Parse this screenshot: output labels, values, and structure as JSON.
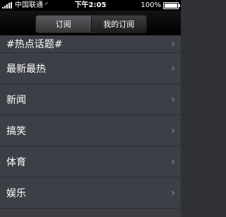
{
  "status_bar": {
    "carrier": "中国联通",
    "time": "下午2:05",
    "battery": "100%"
  },
  "segmented_control": {
    "tabs": [
      {
        "label": "订阅",
        "selected": true
      },
      {
        "label": "我的订阅",
        "selected": false
      }
    ]
  },
  "list": {
    "items": [
      {
        "label": "#热点话题#"
      },
      {
        "label": "最新最热"
      },
      {
        "label": "新闻"
      },
      {
        "label": "搞笑"
      },
      {
        "label": "体育"
      },
      {
        "label": "娱乐"
      }
    ]
  },
  "icons": {
    "signal": "signal-icon",
    "wifi": "wifi-icon",
    "battery": "battery-icon",
    "chevron": "chevron-right-icon"
  },
  "colors": {
    "list_background": "#3c3f45",
    "separator": "#2b2d31",
    "chevron": "#8e9299"
  }
}
